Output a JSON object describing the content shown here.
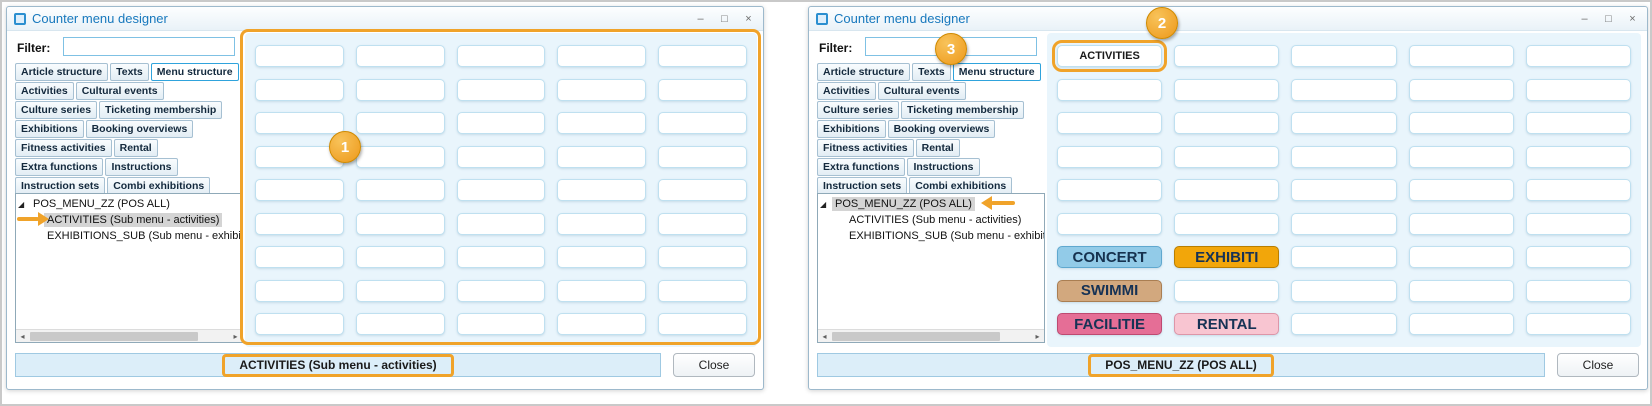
{
  "colors": {
    "annotation": "#F0A32A",
    "title_text": "#1778BD",
    "selected_tab_border": "#2FA3DC",
    "grid_bg": "#E9F5FC",
    "cell_border": "#BFE0F0",
    "status_bg": "#DCEEF9",
    "tree_selection": "#D4D4D4"
  },
  "icons": {
    "minimize": "–",
    "maximize": "□",
    "close": "×",
    "scroll_left": "◂",
    "scroll_right": "▸",
    "tree_expanded": "◢"
  },
  "windows": [
    {
      "title": "Counter menu designer",
      "filter": {
        "label": "Filter:",
        "value": ""
      },
      "tab_rows": [
        {
          "tabs": [
            {
              "label": "Article structure"
            },
            {
              "label": "Texts"
            },
            {
              "label": "Menu structure",
              "selected": true
            }
          ]
        },
        {
          "tabs": [
            {
              "label": "Activities"
            },
            {
              "label": "Cultural events"
            }
          ]
        },
        {
          "tabs": [
            {
              "label": "Culture series"
            },
            {
              "label": "Ticketing membership"
            }
          ]
        },
        {
          "tabs": [
            {
              "label": "Exhibitions"
            },
            {
              "label": "Booking overviews"
            }
          ]
        },
        {
          "tabs": [
            {
              "label": "Fitness activities"
            },
            {
              "label": "Rental"
            }
          ]
        },
        {
          "tabs": [
            {
              "label": "Extra functions"
            },
            {
              "label": "Instructions"
            }
          ]
        },
        {
          "tabs": [
            {
              "label": "Instruction sets"
            },
            {
              "label": "Combi exhibitions"
            }
          ]
        }
      ],
      "tree": {
        "items": [
          {
            "glyph": "◢",
            "label": "POS_MENU_ZZ (POS ALL)"
          },
          {
            "glyph": "",
            "label": "ACTIVITIES (Sub menu - activities)",
            "indent": true,
            "selected": true
          },
          {
            "glyph": "",
            "label": "EXHIBITIONS_SUB (Sub menu - exhibitio",
            "indent": true
          }
        ]
      },
      "grid": {
        "rows": 9,
        "cols": 5,
        "buttons": []
      },
      "status_text": "ACTIVITIES (Sub menu - activities)",
      "close_label": "Close",
      "annotations": {
        "steps": [
          "1"
        ]
      }
    },
    {
      "title": "Counter menu designer",
      "filter": {
        "label": "Filter:",
        "value": ""
      },
      "tab_rows": [
        {
          "tabs": [
            {
              "label": "Article structure"
            },
            {
              "label": "Texts"
            },
            {
              "label": "Menu structure",
              "selected": true
            }
          ]
        },
        {
          "tabs": [
            {
              "label": "Activities"
            },
            {
              "label": "Cultural events"
            }
          ]
        },
        {
          "tabs": [
            {
              "label": "Culture series"
            },
            {
              "label": "Ticketing membership"
            }
          ]
        },
        {
          "tabs": [
            {
              "label": "Exhibitions"
            },
            {
              "label": "Booking overviews"
            }
          ]
        },
        {
          "tabs": [
            {
              "label": "Fitness activities"
            },
            {
              "label": "Rental"
            }
          ]
        },
        {
          "tabs": [
            {
              "label": "Extra functions"
            },
            {
              "label": "Instructions"
            }
          ]
        },
        {
          "tabs": [
            {
              "label": "Instruction sets"
            },
            {
              "label": "Combi exhibitions"
            }
          ]
        }
      ],
      "tree": {
        "items": [
          {
            "glyph": "◢",
            "label": "POS_MENU_ZZ (POS ALL)",
            "selected": true
          },
          {
            "glyph": "",
            "label": "ACTIVITIES (Sub menu - activities)",
            "indent": true
          },
          {
            "glyph": "",
            "label": "EXHIBITIONS_SUB (Sub menu - exhibitio",
            "indent": true
          }
        ]
      },
      "grid": {
        "rows": 9,
        "cols": 5,
        "buttons": [
          {
            "row": 0,
            "col": 0,
            "label": "ACTIVITIES",
            "fg": "#1A1A1A",
            "fs": "11px",
            "highlight": true
          },
          {
            "row": 6,
            "col": 0,
            "label": "CONCERT",
            "bg": "#92CBE8",
            "border": "#5FA8CF",
            "fg": "#16324F",
            "fs": "15px"
          },
          {
            "row": 6,
            "col": 1,
            "label": "EXHIBITI",
            "bg": "#F2A60A",
            "border": "#B97E00",
            "fg": "#163255",
            "fs": "15px"
          },
          {
            "row": 7,
            "col": 0,
            "label": "SWIMMI",
            "bg": "#D2A87E",
            "border": "#AA7E52",
            "fg": "#163255",
            "fs": "15px"
          },
          {
            "row": 8,
            "col": 0,
            "label": "FACILITIE",
            "bg": "#E56E96",
            "border": "#BE4A71",
            "fg": "#163255",
            "fs": "15px"
          },
          {
            "row": 8,
            "col": 1,
            "label": "RENTAL",
            "bg": "#F8C5D1",
            "border": "#DD96A8",
            "fg": "#163255",
            "fs": "15px"
          }
        ]
      },
      "status_text": "POS_MENU_ZZ (POS ALL)",
      "close_label": "Close",
      "annotations": {
        "steps": [
          "2",
          "3"
        ]
      }
    }
  ]
}
